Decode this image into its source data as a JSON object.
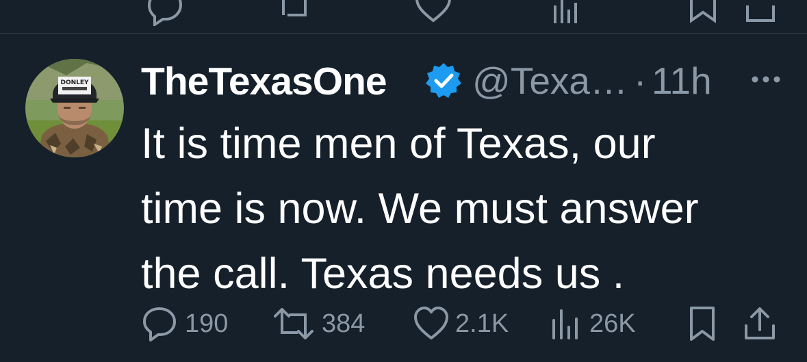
{
  "tweet": {
    "display_name": "TheTexasOne",
    "handle": "@Texa…",
    "separator": "·",
    "timestamp": "11h",
    "avatar_cap_text": "DONLEY",
    "text_lines": [
      "It is time men of Texas, our",
      "time is now. We must answer",
      "the call. Texas needs us ."
    ],
    "stats": {
      "replies": "190",
      "reposts": "384",
      "likes": "2.1K",
      "views": "26K"
    }
  },
  "colors": {
    "background": "#15202b",
    "text": "#ffffff",
    "secondary_text": "#8b98a5",
    "verified_badge": "#1d9bf0",
    "divider": "#38444d"
  },
  "icons": {
    "verified": "verified-badge-icon",
    "more": "more-options-icon",
    "reply": "reply-icon",
    "repost": "repost-icon",
    "like": "like-icon",
    "views": "views-icon",
    "bookmark": "bookmark-icon",
    "share": "share-icon"
  }
}
